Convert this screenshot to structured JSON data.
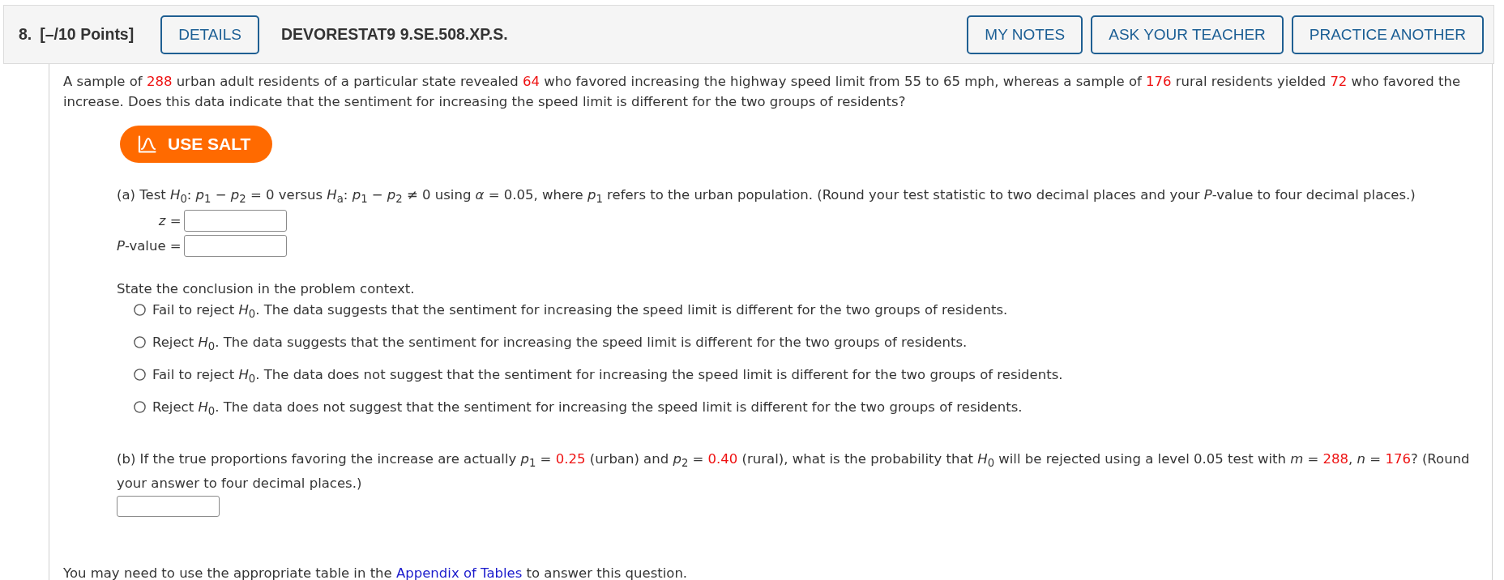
{
  "header": {
    "number": "8.",
    "points": "[–/10 Points]",
    "details_button": "DETAILS",
    "code": "DEVORESTAT9 9.SE.508.XP.S.",
    "buttons": [
      "MY NOTES",
      "ASK YOUR TEACHER",
      "PRACTICE ANOTHER"
    ]
  },
  "question": {
    "segments": [
      {
        "kind": "plain",
        "text": "A sample of "
      },
      {
        "kind": "given",
        "text": "288"
      },
      {
        "kind": "plain",
        "text": " urban adult residents of a particular state revealed "
      },
      {
        "kind": "given",
        "text": "64"
      },
      {
        "kind": "plain",
        "text": " who favored increasing the highway speed limit from 55 to 65 mph, whereas a sample of "
      },
      {
        "kind": "given",
        "text": "176"
      },
      {
        "kind": "plain",
        "text": " rural residents yielded "
      },
      {
        "kind": "given",
        "text": "72"
      },
      {
        "kind": "plain",
        "text": " who favored the increase. Does this data indicate that the sentiment for increasing the speed limit is different for the two groups of residents?"
      }
    ]
  },
  "salt_button": "USE SALT",
  "part_a": {
    "prompt": "(a) Test *H*$_{0}$: *p*$_{1}$ − *p*$_{2}$ = 0 versus *H*$_{a}$: *p*$_{1}$ − *p*$_{2}$ ≠ 0 using *α* = 0.05, where *p*$_{1}$ refers to the urban population. (Round your test statistic to two decimal places and your *P*-value to four decimal places.)",
    "fields": [
      {
        "label": "*z* ="
      },
      {
        "label": "*P*-value ="
      }
    ],
    "conclusion_prompt": "State the conclusion in the problem context.",
    "options": [
      {
        "label": "Fail to reject *H*$_{0}$. The data suggests that the sentiment for increasing the speed limit is different for the two groups of residents.",
        "selected": false
      },
      {
        "label": "Reject *H*$_{0}$. The data suggests that the sentiment for increasing the speed limit is different for the two groups of residents.",
        "selected": false
      },
      {
        "label": "Fail to reject *H*$_{0}$. The data does not suggest that the sentiment for increasing the speed limit is different for the two groups of residents.",
        "selected": false
      },
      {
        "label": "Reject *H*$_{0}$. The data does not suggest that the sentiment for increasing the speed limit is different for the two groups of residents.",
        "selected": false
      }
    ]
  },
  "part_b": {
    "segments": [
      {
        "kind": "plain",
        "text": "(b) If the true proportions favoring the increase are actually *p*$_{1}$ = "
      },
      {
        "kind": "given",
        "text": "0.25"
      },
      {
        "kind": "plain",
        "text": " (urban) and *p*$_{2}$ = "
      },
      {
        "kind": "given",
        "text": "0.40"
      },
      {
        "kind": "plain",
        "text": " (rural), what is the probability that *H*$_{0}$ will be rejected using a level 0.05 test with *m* = "
      },
      {
        "kind": "given",
        "text": "288"
      },
      {
        "kind": "plain",
        "text": ", *n* = "
      },
      {
        "kind": "given",
        "text": "176"
      },
      {
        "kind": "plain",
        "text": "? (Round your answer to four decimal places.)"
      }
    ]
  },
  "footer": {
    "segments": [
      {
        "kind": "plain",
        "text": "You may need to use the appropriate table in the "
      },
      {
        "kind": "link",
        "text": "Appendix of Tables"
      },
      {
        "kind": "plain",
        "text": " to answer this question."
      }
    ]
  }
}
